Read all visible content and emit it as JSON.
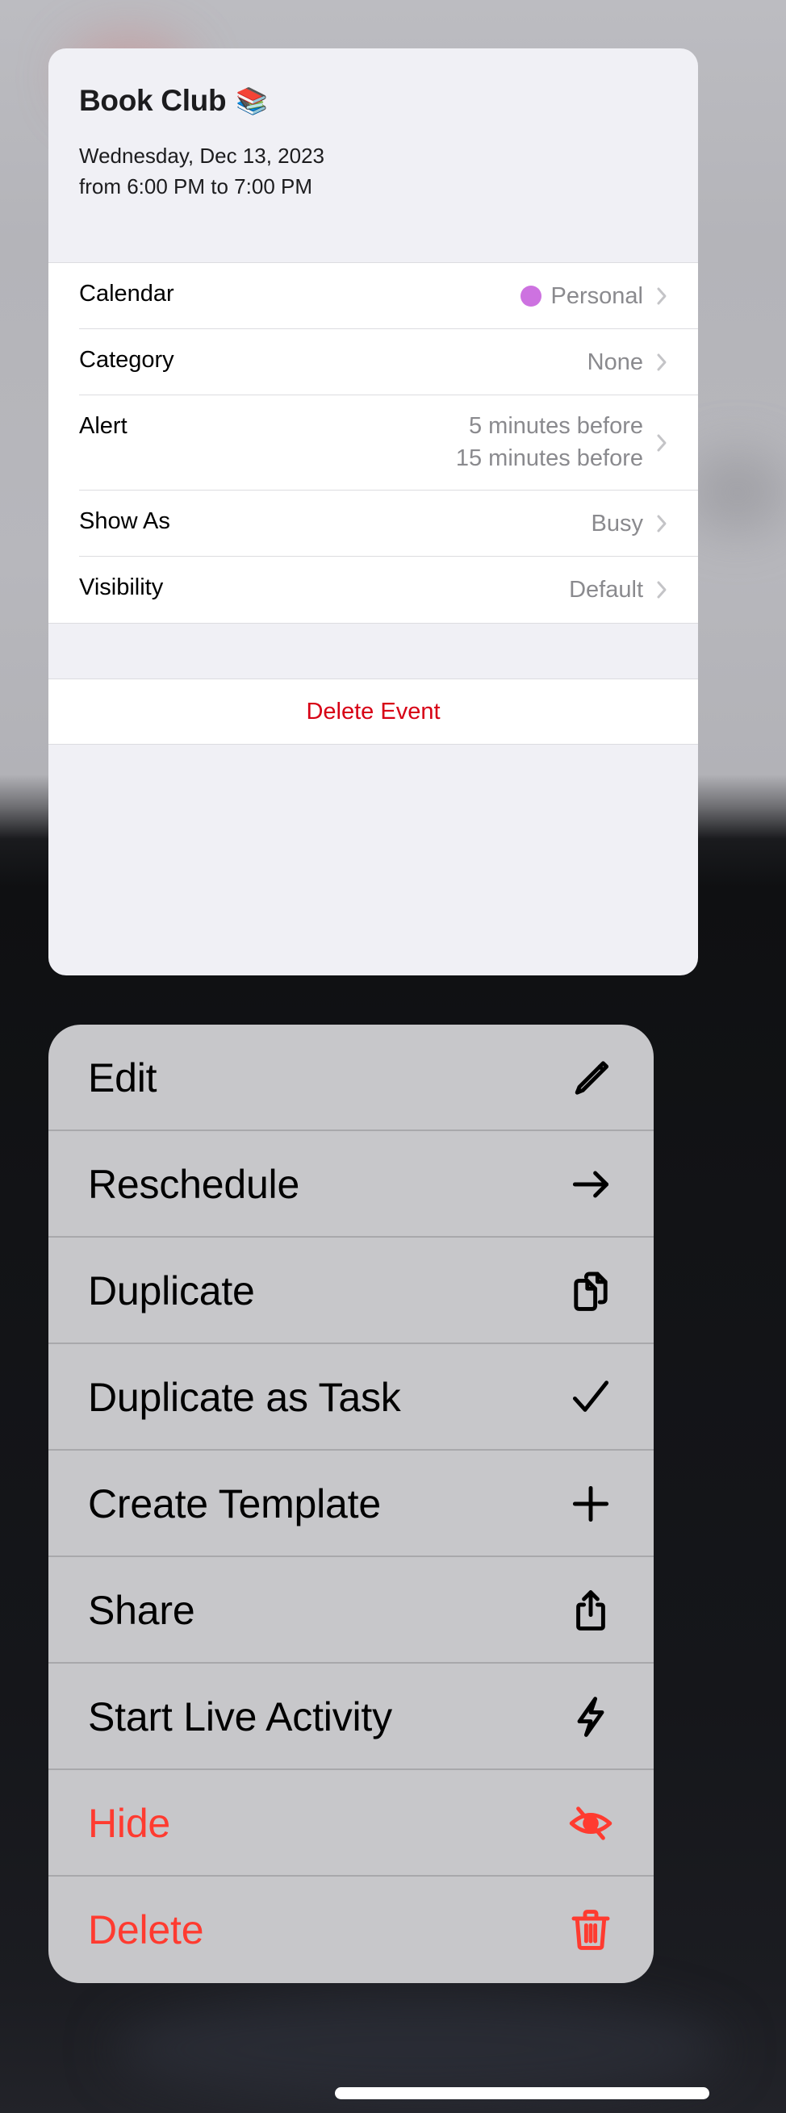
{
  "event": {
    "title": "Book Club",
    "title_emoji": "📚",
    "date": "Wednesday, Dec 13, 2023",
    "time": "from 6:00 PM to 7:00 PM",
    "details": [
      {
        "label": "Calendar",
        "value": "Personal",
        "color": "#cd72e0"
      },
      {
        "label": "Category",
        "value": "None"
      },
      {
        "label": "Alert",
        "values": [
          "5 minutes before",
          "15 minutes before"
        ]
      },
      {
        "label": "Show As",
        "value": "Busy"
      },
      {
        "label": "Visibility",
        "value": "Default"
      }
    ],
    "delete_label": "Delete Event"
  },
  "context_menu": {
    "items": [
      {
        "label": "Edit",
        "icon": "pencil-icon",
        "destructive": false
      },
      {
        "label": "Reschedule",
        "icon": "arrow-right-icon",
        "destructive": false
      },
      {
        "label": "Duplicate",
        "icon": "documents-icon",
        "destructive": false
      },
      {
        "label": "Duplicate as Task",
        "icon": "checkmark-icon",
        "destructive": false
      },
      {
        "label": "Create Template",
        "icon": "plus-icon",
        "destructive": false
      },
      {
        "label": "Share",
        "icon": "share-icon",
        "destructive": false
      },
      {
        "label": "Start Live Activity",
        "icon": "bolt-icon",
        "destructive": false
      },
      {
        "label": "Hide",
        "icon": "eye-slash-icon",
        "destructive": true
      },
      {
        "label": "Delete",
        "icon": "trash-icon",
        "destructive": true
      }
    ]
  },
  "colors": {
    "destructive": "#ff3b30",
    "delete_event": "#d70015",
    "calendar_personal": "#cd72e0"
  }
}
